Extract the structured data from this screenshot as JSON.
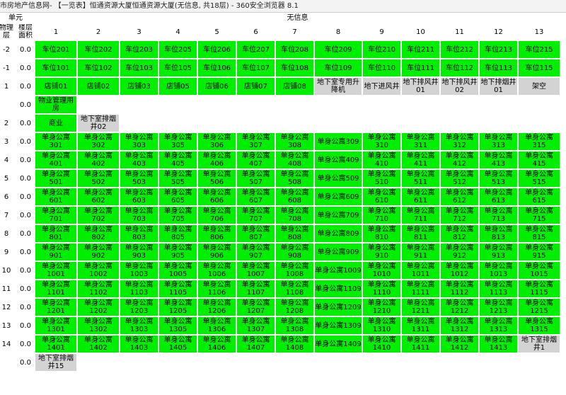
{
  "window": {
    "title": "市房地产信息网- 【一览表】恒通资源大厦恒通资源大厦(无信息, 共18层) - 360安全浏览器 8.1"
  },
  "table": {
    "unit_label": "单元",
    "unit_name": "无信息",
    "floor_header": "物理层",
    "area_header": "楼层面积",
    "columns": [
      "1",
      "2",
      "3",
      "4",
      "5",
      "6",
      "7",
      "8",
      "9",
      "10",
      "11",
      "12",
      "13"
    ],
    "rows": [
      {
        "floor": "-2",
        "area": "0.0",
        "cells": [
          {
            "t": "车位201",
            "c": "g"
          },
          {
            "t": "车位202",
            "c": "g"
          },
          {
            "t": "车位203",
            "c": "g"
          },
          {
            "t": "车位205",
            "c": "g"
          },
          {
            "t": "车位206",
            "c": "g"
          },
          {
            "t": "车位207",
            "c": "g"
          },
          {
            "t": "车位208",
            "c": "g"
          },
          {
            "t": "车位209",
            "c": "g"
          },
          {
            "t": "车位210",
            "c": "g"
          },
          {
            "t": "车位211",
            "c": "g"
          },
          {
            "t": "车位212",
            "c": "g"
          },
          {
            "t": "车位213",
            "c": "g"
          },
          {
            "t": "车位215",
            "c": "g"
          }
        ]
      },
      {
        "floor": "-1",
        "area": "0.0",
        "cells": [
          {
            "t": "车位101",
            "c": "g"
          },
          {
            "t": "车位102",
            "c": "g"
          },
          {
            "t": "车位103",
            "c": "g"
          },
          {
            "t": "车位105",
            "c": "g"
          },
          {
            "t": "车位106",
            "c": "g"
          },
          {
            "t": "车位107",
            "c": "g"
          },
          {
            "t": "车位108",
            "c": "g"
          },
          {
            "t": "车位109",
            "c": "g"
          },
          {
            "t": "车位110",
            "c": "g"
          },
          {
            "t": "车位111",
            "c": "g"
          },
          {
            "t": "车位112",
            "c": "g"
          },
          {
            "t": "车位113",
            "c": "g"
          },
          {
            "t": "车位115",
            "c": "g"
          }
        ]
      },
      {
        "floor": "1",
        "area": "0.0",
        "cells": [
          {
            "t": "店铺01",
            "c": "g"
          },
          {
            "t": "店铺02",
            "c": "g"
          },
          {
            "t": "店铺03",
            "c": "g"
          },
          {
            "t": "店铺05",
            "c": "g"
          },
          {
            "t": "店铺06",
            "c": "g"
          },
          {
            "t": "店铺07",
            "c": "g"
          },
          {
            "t": "店铺08",
            "c": "g"
          },
          {
            "t": "地下室专用升降机",
            "c": "y"
          },
          {
            "t": "地下进风井",
            "c": "y"
          },
          {
            "t": "地下排风井01",
            "c": "y"
          },
          {
            "t": "地下排风井02",
            "c": "y"
          },
          {
            "t": "地下排烟井01",
            "c": "y"
          },
          {
            "t": "架空",
            "c": "y"
          }
        ]
      },
      {
        "floor": "",
        "area": "0.0",
        "cells": [
          {
            "t": "物业管理用房",
            "c": "g"
          }
        ]
      },
      {
        "floor": "2",
        "area": "0.0",
        "cells": [
          {
            "t": "商业",
            "c": "g"
          },
          {
            "t": "地下室排烟井02",
            "c": "y"
          }
        ]
      },
      {
        "floor": "3",
        "area": "0.0",
        "cells": [
          {
            "t": "单身公寓301",
            "c": "g"
          },
          {
            "t": "单身公寓302",
            "c": "g"
          },
          {
            "t": "单身公寓303",
            "c": "g"
          },
          {
            "t": "单身公寓305",
            "c": "g"
          },
          {
            "t": "单身公寓306",
            "c": "g"
          },
          {
            "t": "单身公寓307",
            "c": "g"
          },
          {
            "t": "单身公寓308",
            "c": "g"
          },
          {
            "t": "单身公寓309",
            "c": "g"
          },
          {
            "t": "单身公寓310",
            "c": "g"
          },
          {
            "t": "单身公寓311",
            "c": "g"
          },
          {
            "t": "单身公寓312",
            "c": "g"
          },
          {
            "t": "单身公寓313",
            "c": "g"
          },
          {
            "t": "单身公寓315",
            "c": "g"
          }
        ]
      },
      {
        "floor": "4",
        "area": "0.0",
        "cells": [
          {
            "t": "单身公寓401",
            "c": "g"
          },
          {
            "t": "单身公寓402",
            "c": "g"
          },
          {
            "t": "单身公寓403",
            "c": "g"
          },
          {
            "t": "单身公寓405",
            "c": "g"
          },
          {
            "t": "单身公寓406",
            "c": "g"
          },
          {
            "t": "单身公寓407",
            "c": "g"
          },
          {
            "t": "单身公寓408",
            "c": "g"
          },
          {
            "t": "单身公寓409",
            "c": "g"
          },
          {
            "t": "单身公寓410",
            "c": "g"
          },
          {
            "t": "单身公寓411",
            "c": "g"
          },
          {
            "t": "单身公寓412",
            "c": "g"
          },
          {
            "t": "单身公寓413",
            "c": "g"
          },
          {
            "t": "单身公寓415",
            "c": "g"
          }
        ]
      },
      {
        "floor": "5",
        "area": "0.0",
        "cells": [
          {
            "t": "单身公寓501",
            "c": "g"
          },
          {
            "t": "单身公寓502",
            "c": "g"
          },
          {
            "t": "单身公寓503",
            "c": "g"
          },
          {
            "t": "单身公寓505",
            "c": "g"
          },
          {
            "t": "单身公寓506",
            "c": "g"
          },
          {
            "t": "单身公寓507",
            "c": "g"
          },
          {
            "t": "单身公寓508",
            "c": "g"
          },
          {
            "t": "单身公寓509",
            "c": "g"
          },
          {
            "t": "单身公寓510",
            "c": "g"
          },
          {
            "t": "单身公寓511",
            "c": "g"
          },
          {
            "t": "单身公寓512",
            "c": "g"
          },
          {
            "t": "单身公寓513",
            "c": "g"
          },
          {
            "t": "单身公寓515",
            "c": "g"
          }
        ]
      },
      {
        "floor": "6",
        "area": "0.0",
        "cells": [
          {
            "t": "单身公寓601",
            "c": "g"
          },
          {
            "t": "单身公寓602",
            "c": "g"
          },
          {
            "t": "单身公寓603",
            "c": "g"
          },
          {
            "t": "单身公寓605",
            "c": "g"
          },
          {
            "t": "单身公寓606",
            "c": "g"
          },
          {
            "t": "单身公寓607",
            "c": "g"
          },
          {
            "t": "单身公寓608",
            "c": "g"
          },
          {
            "t": "单身公寓609",
            "c": "g"
          },
          {
            "t": "单身公寓610",
            "c": "g"
          },
          {
            "t": "单身公寓611",
            "c": "g"
          },
          {
            "t": "单身公寓612",
            "c": "g"
          },
          {
            "t": "单身公寓613",
            "c": "g"
          },
          {
            "t": "单身公寓615",
            "c": "g"
          }
        ]
      },
      {
        "floor": "7",
        "area": "0.0",
        "cells": [
          {
            "t": "单身公寓701",
            "c": "g"
          },
          {
            "t": "单身公寓702",
            "c": "g"
          },
          {
            "t": "单身公寓703",
            "c": "g"
          },
          {
            "t": "单身公寓705",
            "c": "g"
          },
          {
            "t": "单身公寓706",
            "c": "g"
          },
          {
            "t": "单身公寓707",
            "c": "g"
          },
          {
            "t": "单身公寓708",
            "c": "g"
          },
          {
            "t": "单身公寓709",
            "c": "g"
          },
          {
            "t": "单身公寓710",
            "c": "g"
          },
          {
            "t": "单身公寓711",
            "c": "g"
          },
          {
            "t": "单身公寓712",
            "c": "g"
          },
          {
            "t": "单身公寓713",
            "c": "g"
          },
          {
            "t": "单身公寓715",
            "c": "g"
          }
        ]
      },
      {
        "floor": "8",
        "area": "0.0",
        "cells": [
          {
            "t": "单身公寓801",
            "c": "g"
          },
          {
            "t": "单身公寓802",
            "c": "g"
          },
          {
            "t": "单身公寓803",
            "c": "g"
          },
          {
            "t": "单身公寓805",
            "c": "g"
          },
          {
            "t": "单身公寓806",
            "c": "g"
          },
          {
            "t": "单身公寓807",
            "c": "g"
          },
          {
            "t": "单身公寓808",
            "c": "g"
          },
          {
            "t": "单身公寓809",
            "c": "g"
          },
          {
            "t": "单身公寓810",
            "c": "g"
          },
          {
            "t": "单身公寓811",
            "c": "g"
          },
          {
            "t": "单身公寓812",
            "c": "g"
          },
          {
            "t": "单身公寓813",
            "c": "g"
          },
          {
            "t": "单身公寓815",
            "c": "g"
          }
        ]
      },
      {
        "floor": "9",
        "area": "0.0",
        "cells": [
          {
            "t": "单身公寓901",
            "c": "g"
          },
          {
            "t": "单身公寓902",
            "c": "g"
          },
          {
            "t": "单身公寓903",
            "c": "g"
          },
          {
            "t": "单身公寓905",
            "c": "g"
          },
          {
            "t": "单身公寓906",
            "c": "g"
          },
          {
            "t": "单身公寓907",
            "c": "g"
          },
          {
            "t": "单身公寓908",
            "c": "g"
          },
          {
            "t": "单身公寓909",
            "c": "g"
          },
          {
            "t": "单身公寓910",
            "c": "g"
          },
          {
            "t": "单身公寓911",
            "c": "g"
          },
          {
            "t": "单身公寓912",
            "c": "g"
          },
          {
            "t": "单身公寓913",
            "c": "g"
          },
          {
            "t": "单身公寓915",
            "c": "g"
          }
        ]
      },
      {
        "floor": "10",
        "area": "0.0",
        "cells": [
          {
            "t": "单身公寓1001",
            "c": "g"
          },
          {
            "t": "单身公寓1002",
            "c": "g"
          },
          {
            "t": "单身公寓1003",
            "c": "g"
          },
          {
            "t": "单身公寓1005",
            "c": "g"
          },
          {
            "t": "单身公寓1006",
            "c": "g"
          },
          {
            "t": "单身公寓1007",
            "c": "g"
          },
          {
            "t": "单身公寓1008",
            "c": "g"
          },
          {
            "t": "单身公寓1009",
            "c": "g"
          },
          {
            "t": "单身公寓1010",
            "c": "g"
          },
          {
            "t": "单身公寓1011",
            "c": "g"
          },
          {
            "t": "单身公寓1012",
            "c": "g"
          },
          {
            "t": "单身公寓1013",
            "c": "g"
          },
          {
            "t": "单身公寓1015",
            "c": "g"
          }
        ]
      },
      {
        "floor": "11",
        "area": "0.0",
        "cells": [
          {
            "t": "单身公寓1101",
            "c": "g"
          },
          {
            "t": "单身公寓1102",
            "c": "g"
          },
          {
            "t": "单身公寓1103",
            "c": "g"
          },
          {
            "t": "单身公寓1105",
            "c": "g"
          },
          {
            "t": "单身公寓1106",
            "c": "g"
          },
          {
            "t": "单身公寓1107",
            "c": "g"
          },
          {
            "t": "单身公寓1108",
            "c": "g"
          },
          {
            "t": "单身公寓1109",
            "c": "g"
          },
          {
            "t": "单身公寓1110",
            "c": "g"
          },
          {
            "t": "单身公寓1111",
            "c": "g"
          },
          {
            "t": "单身公寓1112",
            "c": "g"
          },
          {
            "t": "单身公寓1113",
            "c": "g"
          },
          {
            "t": "单身公寓1115",
            "c": "g"
          }
        ]
      },
      {
        "floor": "12",
        "area": "0.0",
        "cells": [
          {
            "t": "单身公寓1201",
            "c": "g"
          },
          {
            "t": "单身公寓1202",
            "c": "g"
          },
          {
            "t": "单身公寓1203",
            "c": "g"
          },
          {
            "t": "单身公寓1205",
            "c": "g"
          },
          {
            "t": "单身公寓1206",
            "c": "g"
          },
          {
            "t": "单身公寓1207",
            "c": "g"
          },
          {
            "t": "单身公寓1208",
            "c": "g"
          },
          {
            "t": "单身公寓1209",
            "c": "g"
          },
          {
            "t": "单身公寓1210",
            "c": "g"
          },
          {
            "t": "单身公寓1211",
            "c": "g"
          },
          {
            "t": "单身公寓1212",
            "c": "g"
          },
          {
            "t": "单身公寓1213",
            "c": "g"
          },
          {
            "t": "单身公寓1215",
            "c": "g"
          }
        ]
      },
      {
        "floor": "13",
        "area": "0.0",
        "cells": [
          {
            "t": "单身公寓1301",
            "c": "g"
          },
          {
            "t": "单身公寓1302",
            "c": "g"
          },
          {
            "t": "单身公寓1303",
            "c": "g"
          },
          {
            "t": "单身公寓1305",
            "c": "g"
          },
          {
            "t": "单身公寓1306",
            "c": "g"
          },
          {
            "t": "单身公寓1307",
            "c": "g"
          },
          {
            "t": "单身公寓1308",
            "c": "g"
          },
          {
            "t": "单身公寓1309",
            "c": "g"
          },
          {
            "t": "单身公寓1310",
            "c": "g"
          },
          {
            "t": "单身公寓1311",
            "c": "g"
          },
          {
            "t": "单身公寓1312",
            "c": "g"
          },
          {
            "t": "单身公寓1313",
            "c": "g"
          },
          {
            "t": "单身公寓1315",
            "c": "g"
          }
        ]
      },
      {
        "floor": "14",
        "area": "0.0",
        "cells": [
          {
            "t": "单身公寓1401",
            "c": "g"
          },
          {
            "t": "单身公寓1402",
            "c": "g"
          },
          {
            "t": "单身公寓1403",
            "c": "g"
          },
          {
            "t": "单身公寓1405",
            "c": "g"
          },
          {
            "t": "单身公寓1406",
            "c": "g"
          },
          {
            "t": "单身公寓1407",
            "c": "g"
          },
          {
            "t": "单身公寓1408",
            "c": "g"
          },
          {
            "t": "单身公寓1409",
            "c": "g"
          },
          {
            "t": "单身公寓1410",
            "c": "g"
          },
          {
            "t": "单身公寓1411",
            "c": "g"
          },
          {
            "t": "单身公寓1412",
            "c": "g"
          },
          {
            "t": "单身公寓1413",
            "c": "g"
          },
          {
            "t": "地下室排烟井1",
            "c": "y"
          }
        ]
      },
      {
        "floor": "",
        "area": "0.0",
        "cells": [
          {
            "t": "地下室排烟井15",
            "c": "y"
          }
        ]
      }
    ]
  }
}
